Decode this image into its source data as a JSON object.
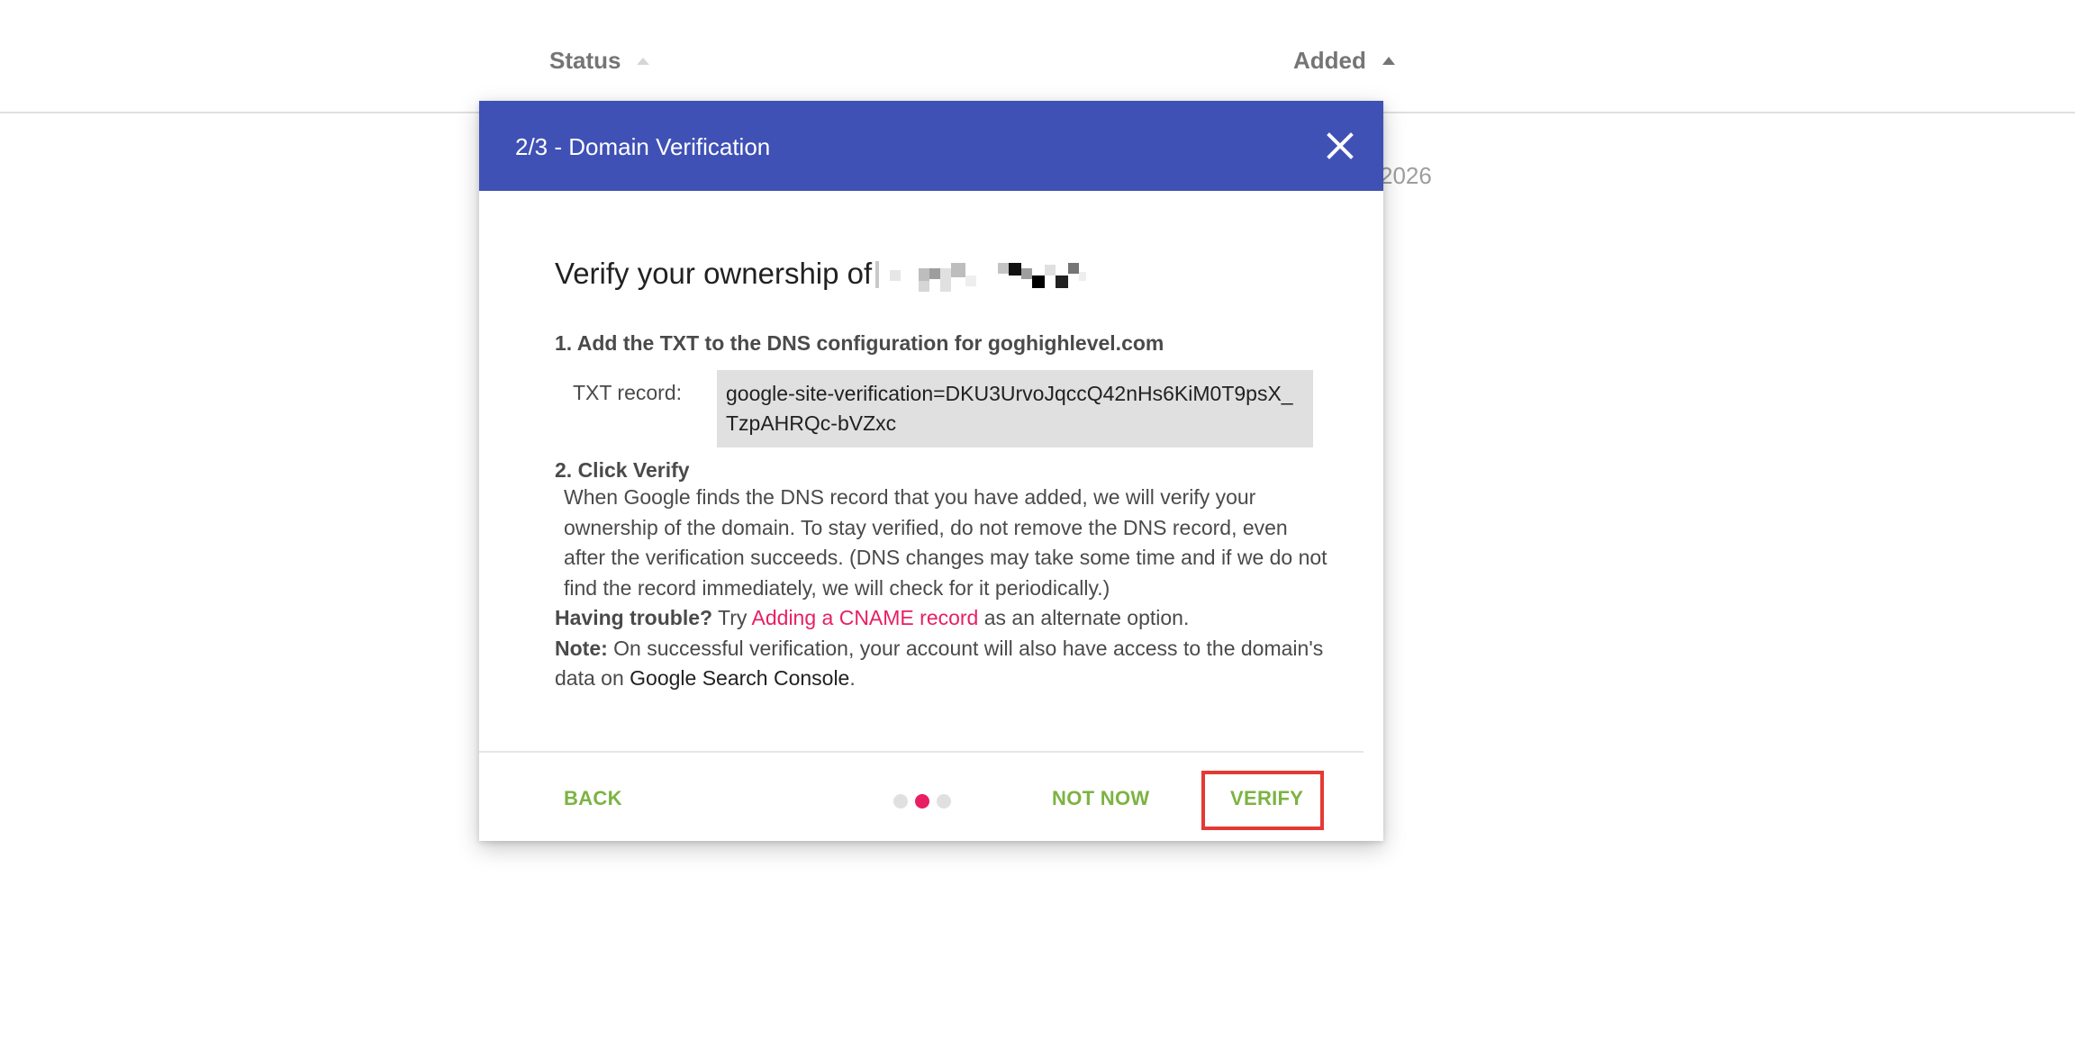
{
  "table_header": {
    "status_label": "Status",
    "added_label": "Added",
    "visible_date_fragment": "2026"
  },
  "dialog": {
    "title": "2/3 - Domain Verification",
    "close_icon": "close-icon",
    "heading": "Verify your ownership of",
    "step1_title": "1. Add the TXT to the DNS configuration for goghighlevel.com",
    "txt_label": "TXT record:",
    "txt_value": "google-site-verification=DKU3UrvoJqccQ42nHs6KiM0T9psX_TzpAHRQc-bVZxc",
    "step2_title": "2. Click Verify",
    "step2_body": "When Google finds the DNS record that you have added, we will verify your ownership of the domain. To stay verified, do not remove the DNS record, even after the verification succeeds. (DNS changes may take some time and if we do not find the record immediately, we will check for it periodically.)",
    "trouble_label": "Having trouble?",
    "trouble_pre": " Try ",
    "trouble_link": "Adding a CNAME record",
    "trouble_post": " as an alternate option.",
    "note_label": "Note:",
    "note_text": " On successful verification, your account will also have access to the domain's data on ",
    "note_link": "Google Search Console",
    "note_end": "."
  },
  "footer": {
    "back_label": "BACK",
    "not_now_label": "NOT NOW",
    "verify_label": "VERIFY",
    "steps_total": 3,
    "step_active": 2
  },
  "colors": {
    "header_bg": "#3f51b5",
    "button_green": "#7cb342",
    "link_pink": "#e91e63",
    "highlight_red": "#e53935"
  }
}
